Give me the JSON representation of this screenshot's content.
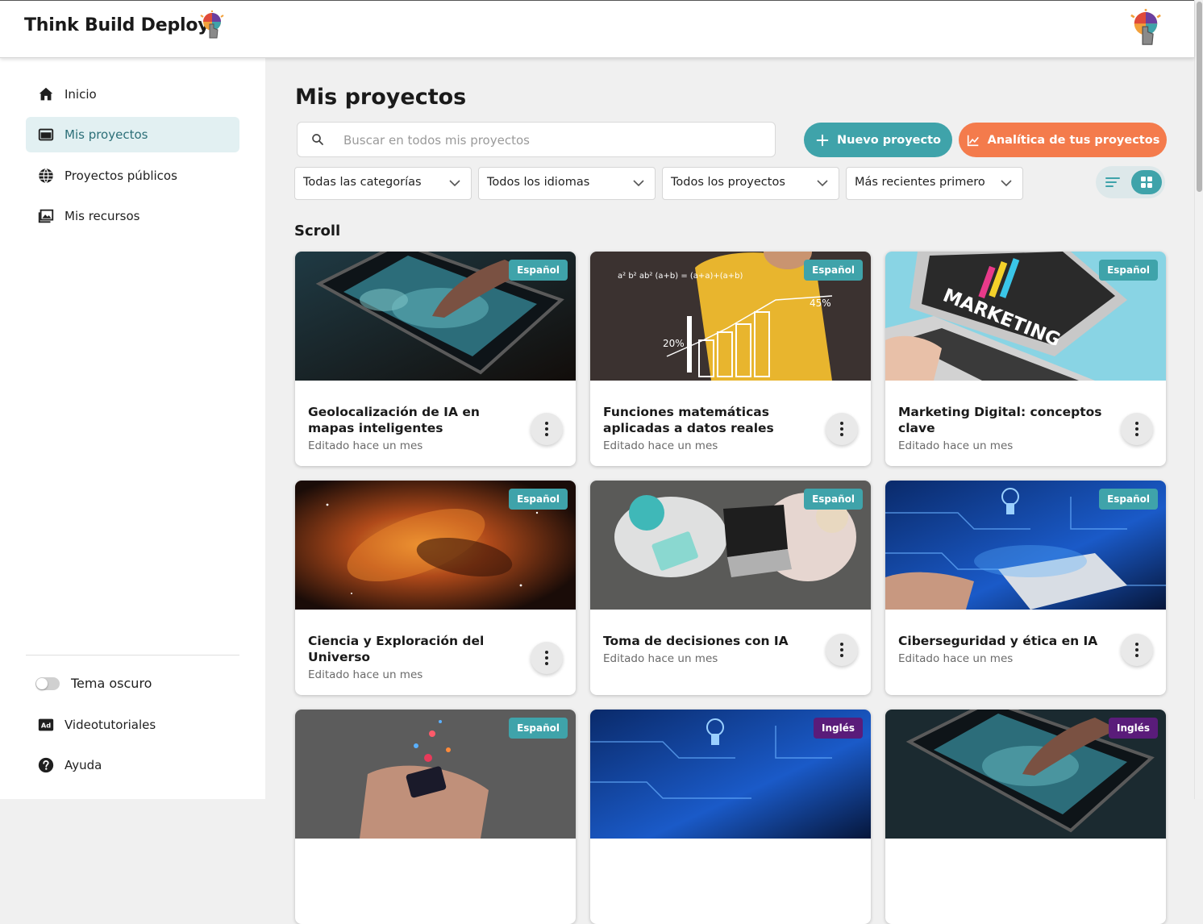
{
  "app": {
    "brand": "Think Build Deploy"
  },
  "sidebar": {
    "items": [
      {
        "label": "Inicio",
        "icon": "home-icon",
        "active": false
      },
      {
        "label": "Mis proyectos",
        "icon": "projects-icon",
        "active": true
      },
      {
        "label": "Proyectos públicos",
        "icon": "globe-icon",
        "active": false
      },
      {
        "label": "Mis recursos",
        "icon": "images-icon",
        "active": false
      }
    ],
    "dark_theme_label": "Tema oscuro",
    "dark_theme_on": false,
    "bottom_items": [
      {
        "label": "Videotutoriales",
        "icon": "ad-icon"
      },
      {
        "label": "Ayuda",
        "icon": "help-icon"
      }
    ]
  },
  "main": {
    "title": "Mis proyectos",
    "search_placeholder": "Buscar en todos mis proyectos",
    "new_project_label": "Nuevo proyecto",
    "analytics_label": "Analítica de tus proyectos",
    "filters": [
      "Todas las categorías",
      "Todos los idiomas",
      "Todos los proyectos",
      "Más recientes primero"
    ],
    "view_mode": "grid",
    "section_title": "Scroll"
  },
  "cards": [
    {
      "title": "Geolocalización de IA en mapas inteligentes",
      "meta": "Editado hace un mes",
      "language": "Español"
    },
    {
      "title": "Funciones matemáticas aplicadas a datos reales",
      "meta": "Editado hace un mes",
      "language": "Español"
    },
    {
      "title": "Marketing Digital: conceptos clave",
      "meta": "Editado hace un mes",
      "language": "Español"
    },
    {
      "title": "Ciencia y Exploración del Universo",
      "meta": "Editado hace un mes",
      "language": "Español"
    },
    {
      "title": "Toma de decisiones con IA",
      "meta": "Editado hace un mes",
      "language": "Español"
    },
    {
      "title": "Ciberseguridad y ética en IA",
      "meta": "Editado hace un mes",
      "language": "Español"
    },
    {
      "title": "",
      "meta": "",
      "language": "Español"
    },
    {
      "title": "",
      "meta": "",
      "language": "Inglés"
    },
    {
      "title": "",
      "meta": "",
      "language": "Inglés"
    }
  ],
  "thumb_texts": {
    "math_formula": "a² b² ab² (a+b) = (a+a)+(a+b)",
    "math_percent_high": "45%",
    "math_percent_low": "20%",
    "marketing_word": "MARKETING"
  },
  "colors": {
    "accent": "#3fa3aa",
    "orange": "#f47b4c",
    "badge_es": "#3fa3aa",
    "badge_en": "#5a1c7a",
    "active_nav_bg": "#e2f0f2"
  }
}
